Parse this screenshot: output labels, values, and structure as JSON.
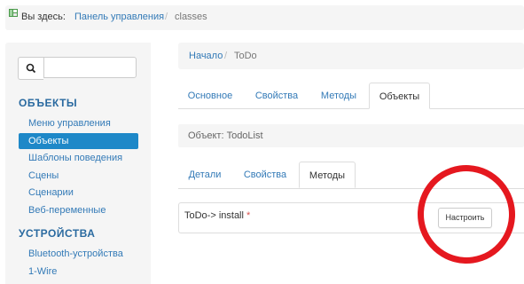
{
  "topbar": {
    "you_are_here": "Вы здесь:",
    "link": "Панель управления",
    "current": "classes",
    "sep": "/"
  },
  "sidebar": {
    "search": {
      "placeholder": "",
      "value": ""
    },
    "sections": [
      {
        "title": "ОБЪЕКТЫ",
        "items": [
          "Меню управления",
          "Объекты",
          "Шаблоны поведения",
          "Сцены",
          "Сценарии",
          "Веб-переменные"
        ]
      },
      {
        "title": "УСТРОЙСТВА",
        "items": [
          "Bluetooth-устройства",
          "1-Wire"
        ]
      }
    ]
  },
  "breadcrumb": {
    "home": "Начало",
    "sep": "/",
    "current": "ToDo"
  },
  "tabs_main": [
    "Основное",
    "Свойства",
    "Методы",
    "Объекты"
  ],
  "object_label": "Объект: TodoList",
  "tabs_sub": [
    "Детали",
    "Свойства",
    "Методы"
  ],
  "method_row": {
    "name": "ToDo-> install",
    "required_mark": "*",
    "button": "Настроить"
  },
  "colors": {
    "accent": "#1e88c8",
    "link": "#337ab7",
    "annotation": "#e5181f"
  }
}
